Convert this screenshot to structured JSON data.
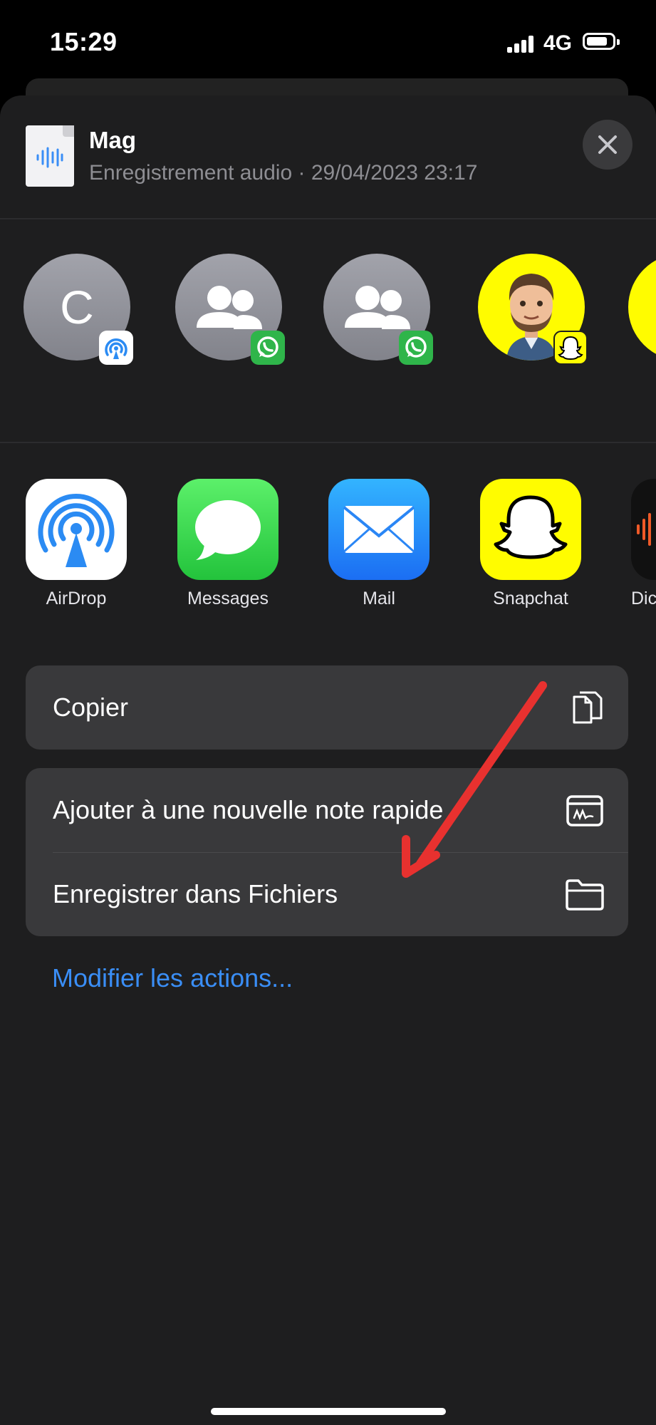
{
  "status_bar": {
    "time": "15:29",
    "network": "4G"
  },
  "file": {
    "title": "Mag",
    "meta": "Enregistrement audio · 29/04/2023 23:17"
  },
  "contacts": [
    {
      "initial": "C",
      "badge": "airdrop"
    },
    {
      "initial": "",
      "badge": "whatsapp"
    },
    {
      "initial": "",
      "badge": "whatsapp"
    },
    {
      "initial": "",
      "badge": "snapchat"
    }
  ],
  "apps": [
    {
      "label": "AirDrop",
      "icon": "airdrop-icon"
    },
    {
      "label": "Messages",
      "icon": "messages-icon"
    },
    {
      "label": "Mail",
      "icon": "mail-icon"
    },
    {
      "label": "Snapchat",
      "icon": "snapchat-icon"
    },
    {
      "label": "Dic",
      "icon": "dictaphone-icon"
    }
  ],
  "actions": {
    "copy": "Copier",
    "quick_note": "Ajouter à une nouvelle note rapide",
    "save_files": "Enregistrer dans Fichiers"
  },
  "modify_actions": "Modifier les actions...",
  "colors": {
    "sheet_bg": "#1e1e1f",
    "row_bg": "#39393b",
    "link": "#3a8ef6",
    "annotation_arrow": "#e8312f"
  }
}
